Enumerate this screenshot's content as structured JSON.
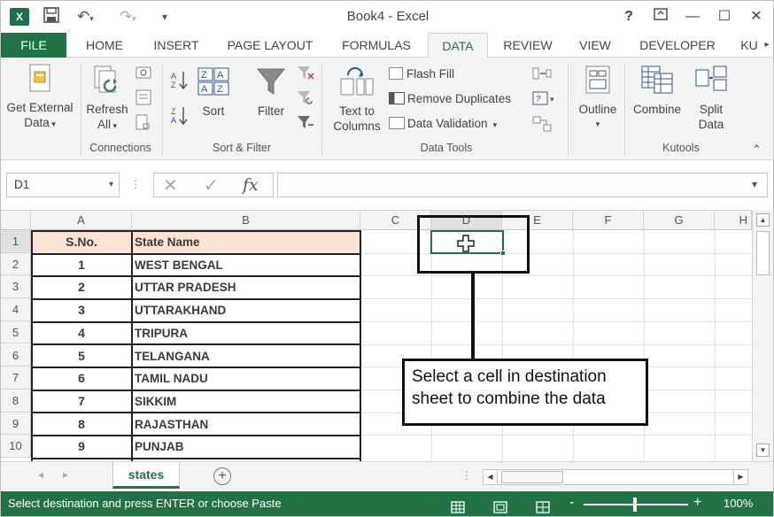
{
  "window": {
    "title": "Book4 - Excel",
    "logo_text": "X",
    "help": "?",
    "minimize": "—",
    "maximize": "☐",
    "close": "✕"
  },
  "tabs": [
    {
      "label": "FILE"
    },
    {
      "label": "HOME"
    },
    {
      "label": "INSERT"
    },
    {
      "label": "PAGE LAYOUT"
    },
    {
      "label": "FORMULAS"
    },
    {
      "label": "DATA"
    },
    {
      "label": "REVIEW"
    },
    {
      "label": "VIEW"
    },
    {
      "label": "DEVELOPER"
    },
    {
      "label": "KU"
    }
  ],
  "ribbon": {
    "get_external": [
      "Get External",
      "Data"
    ],
    "refresh": [
      "Refresh",
      "All"
    ],
    "sort_label": "Sort",
    "filter_label": "Filter",
    "text_to_columns": [
      "Text to",
      "Columns"
    ],
    "flash_fill": "Flash Fill",
    "remove_duplicates": "Remove Duplicates",
    "data_validation": "Data Validation",
    "outline": "Outline",
    "combine": "Combine",
    "split": [
      "Split",
      "Data"
    ],
    "groups": {
      "connections": "Connections",
      "sort_filter": "Sort & Filter",
      "data_tools": "Data Tools",
      "kutools": "Kutools"
    }
  },
  "formula_bar": {
    "name_box": "D1",
    "fx": "fx",
    "value": ""
  },
  "grid": {
    "columns": [
      "A",
      "B",
      "C",
      "D",
      "E",
      "F",
      "G",
      "H"
    ],
    "rows": [
      "1",
      "2",
      "3",
      "4",
      "5",
      "6",
      "7",
      "8",
      "9",
      "10"
    ],
    "header": {
      "a": "S.No.",
      "b": "State Name"
    },
    "data": [
      {
        "a": "1",
        "b": "WEST BENGAL"
      },
      {
        "a": "2",
        "b": "UTTAR PRADESH"
      },
      {
        "a": "3",
        "b": "UTTARAKHAND"
      },
      {
        "a": "4",
        "b": "TRIPURA"
      },
      {
        "a": "5",
        "b": "TELANGANA"
      },
      {
        "a": "6",
        "b": "TAMIL NADU"
      },
      {
        "a": "7",
        "b": "SIKKIM"
      },
      {
        "a": "8",
        "b": "RAJASTHAN"
      },
      {
        "a": "9",
        "b": "PUNJAB"
      }
    ],
    "header_fill_color": "#fbe4d5"
  },
  "annotation": {
    "line1": "Select a cell in destination",
    "line2": "sheet to combine the data"
  },
  "sheets": {
    "active": "states",
    "add": "+"
  },
  "status": {
    "message": "Select destination and press ENTER or choose Paste",
    "zoom": "100%",
    "minus": "-",
    "plus": "+"
  },
  "colors": {
    "excel_green": "#217346",
    "ribbon_bg": "#f3f3f3"
  }
}
